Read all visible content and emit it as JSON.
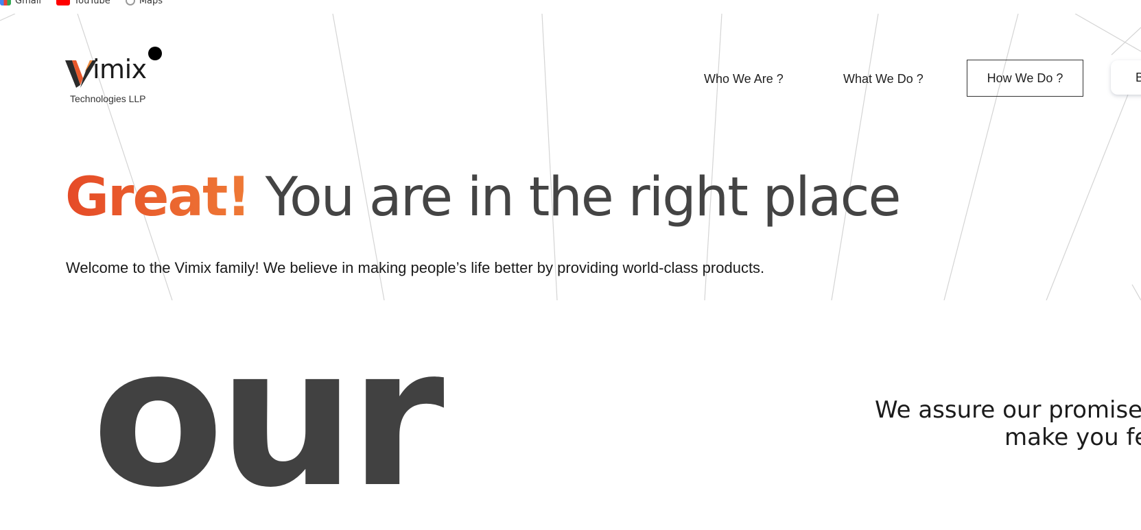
{
  "bookmarks": [
    {
      "label": "Gmail",
      "icon": "gmail-icon"
    },
    {
      "label": "YouTube",
      "icon": "youtube-icon"
    },
    {
      "label": "Maps",
      "icon": "maps-icon"
    }
  ],
  "logo": {
    "word": "imix",
    "subtitle": "Technologies LLP",
    "colors": {
      "orange": "#e8582b",
      "dark": "#2b2b2b"
    }
  },
  "nav": {
    "who": "Who We Are ?",
    "what": "What We Do ?",
    "how": "How We Do ?",
    "cut": "B"
  },
  "hero": {
    "accent": "Great!",
    "rest": " You are in the right place",
    "subtitle": "Welcome to the Vimix family! We believe in making people’s life better by providing world-class products.",
    "accent_color": "#e8582b"
  },
  "section2": {
    "big_word": "our",
    "line1": "We assure our promise",
    "line2": "make you fe"
  }
}
